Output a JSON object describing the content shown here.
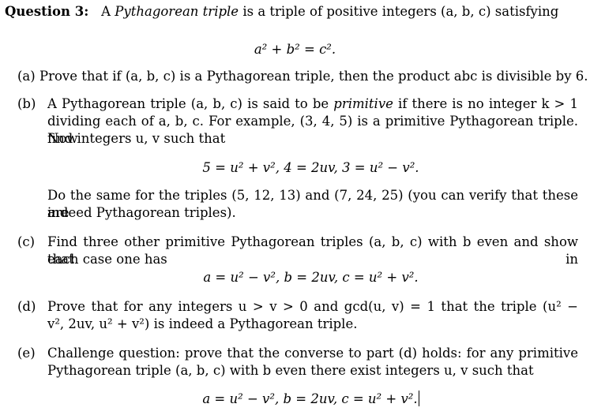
{
  "question": {
    "label": "Question 3:",
    "intro_prefix": "A ",
    "intro_italic": "Pythagorean triple",
    "intro_suffix": " is a triple of positive integers (a, b, c) satisfying",
    "equation": "a² + b² = c²."
  },
  "parts": {
    "a": {
      "label": "(a)",
      "line1": "Prove that if (a, b, c) is a Pythagorean triple, then the product abc is divisible by 6."
    },
    "b": {
      "label": "(b)",
      "line1_prefix": "A Pythagorean triple (a, b, c) is said to be ",
      "line1_italic": "primitive",
      "line1_suffix": " if there is no integer k > 1",
      "line2": "dividing each of a, b, c. For example, (3, 4, 5) is a primitive Pythagorean triple. Now",
      "line3": "find integers u, v such that",
      "equation": "5 = u² + v², 4 = 2uv, 3 = u² − v².",
      "line4": "Do the same for the triples (5, 12, 13) and (7, 24, 25) (you can verify that these are",
      "line5": "indeed Pythagorean triples)."
    },
    "c": {
      "label": "(c)",
      "line1": "Find three other primitive Pythagorean triples (a, b, c) with b even and show that in",
      "line2": "each case one has",
      "equation": "a = u² − v², b = 2uv, c = u² + v²."
    },
    "d": {
      "label": "(d)",
      "line1": "Prove that for any integers u > v > 0 and gcd(u, v) = 1 that the triple (u² −",
      "line2": "v², 2uv, u² + v²) is indeed a Pythagorean triple."
    },
    "e": {
      "label": "(e)",
      "line1": "Challenge question: prove that the converse to part (d) holds: for any primitive",
      "line2": "Pythagorean triple (a, b, c) with b even there exist integers u, v such that",
      "equation": "a = u² − v², b = 2uv, c = u² + v²."
    }
  }
}
